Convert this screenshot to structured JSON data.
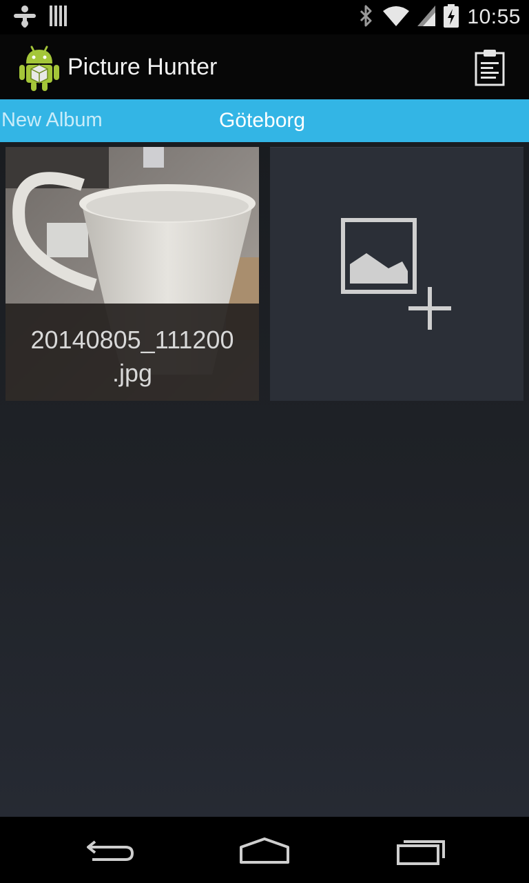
{
  "status_bar": {
    "time": "10:55",
    "icons": [
      "notification-icon",
      "barcode-icon",
      "bluetooth-icon",
      "wifi-icon",
      "signal-icon",
      "battery-charging-icon"
    ]
  },
  "action_bar": {
    "title": "Picture Hunter",
    "app_icon": "android-robot-icon",
    "action_icon": "clipboard-icon"
  },
  "tabs": {
    "left": "New Album",
    "current": "Göteborg",
    "accent": "#33b5e5"
  },
  "grid": {
    "photo_caption": "20140805_111200\n.jpg",
    "add_tile_icon": "add-image-icon"
  },
  "nav_bar": {
    "icons": [
      "back-icon",
      "home-icon",
      "recents-icon"
    ]
  }
}
